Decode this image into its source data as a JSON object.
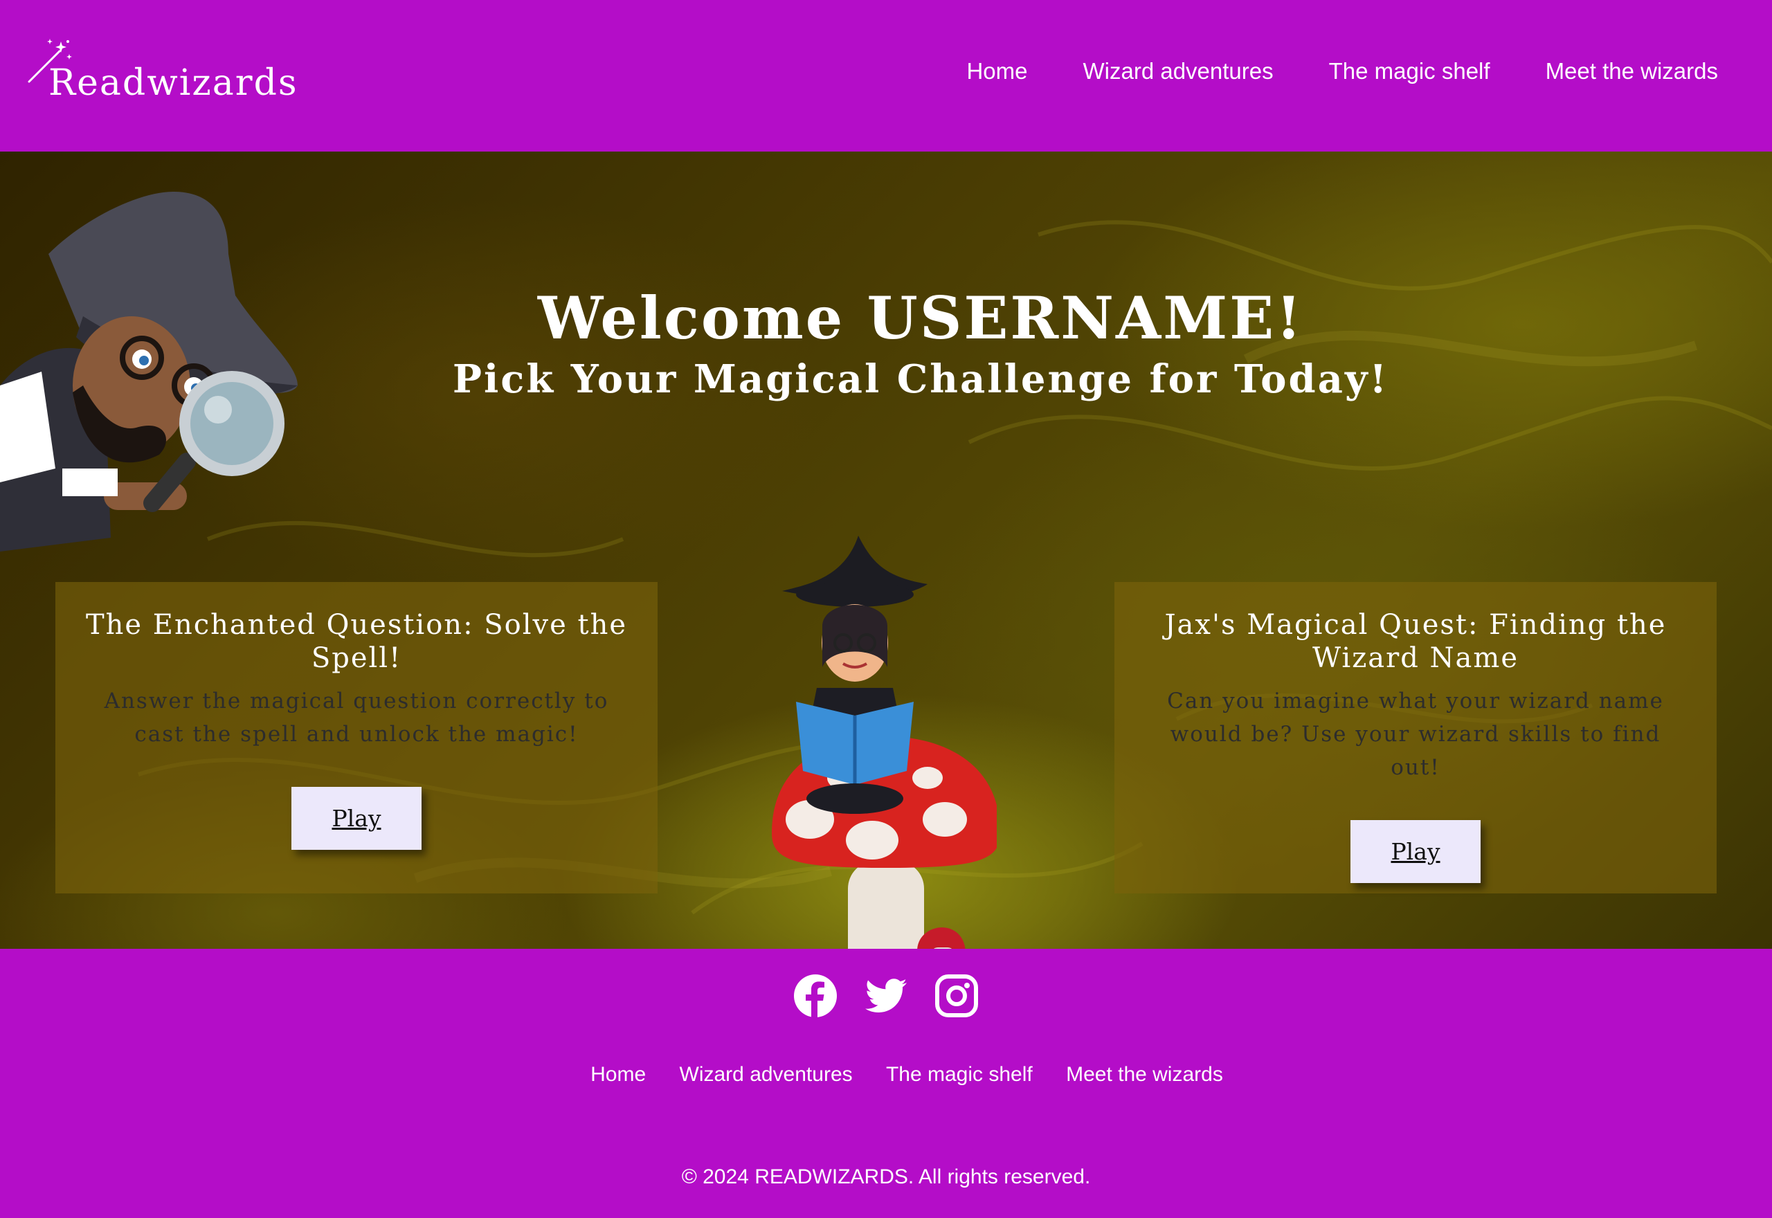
{
  "header": {
    "logo_text": "Readwizards",
    "logo_icon": "magic-wand-icon",
    "nav": [
      "Home",
      "Wizard adventures",
      "The magic shelf",
      "Meet the wizards"
    ]
  },
  "hero": {
    "title": "Welcome USERNAME!",
    "subtitle": "Pick Your Magical Challenge for Today!",
    "cards": [
      {
        "title": "The Enchanted Question: Solve the Spell!",
        "description": "Answer the magical question correctly to cast the spell and unlock the magic!",
        "button": "Play"
      },
      {
        "title": "Jax's Magical Quest: Finding the Wizard Name",
        "description": "Can you imagine what your wizard name would be? Use your wizard skills to find out!",
        "button": "Play"
      }
    ]
  },
  "footer": {
    "social": [
      "facebook-icon",
      "twitter-icon",
      "instagram-icon"
    ],
    "nav": [
      "Home",
      "Wizard adventures",
      "The magic shelf",
      "Meet the wizards"
    ],
    "copyright": "© 2024 READWIZARDS. All rights reserved."
  },
  "colors": {
    "brand_purple": "#b40dc8",
    "hero_olive": "#4a3d03",
    "card_bg": "#7a620c",
    "button_bg": "#ece8fb"
  }
}
